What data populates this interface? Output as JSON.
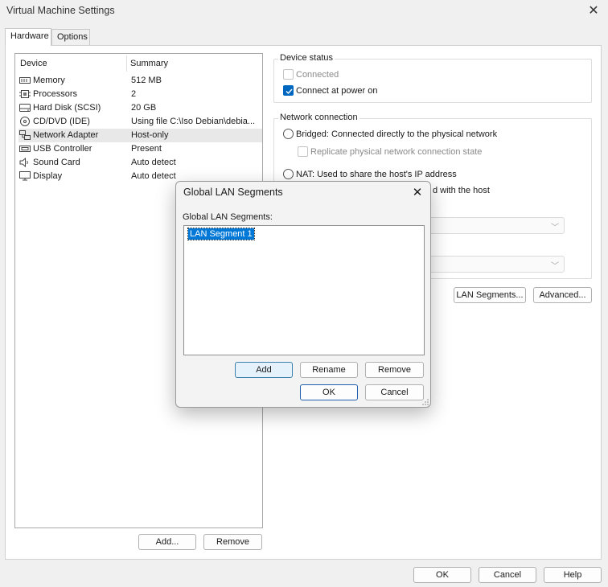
{
  "window": {
    "title": "Virtual Machine Settings"
  },
  "tabs": [
    {
      "label": "Hardware"
    },
    {
      "label": "Options"
    }
  ],
  "device_list": {
    "headers": {
      "device": "Device",
      "summary": "Summary"
    },
    "rows": [
      {
        "icon": "memory-icon",
        "device": "Memory",
        "summary": "512 MB"
      },
      {
        "icon": "processor-icon",
        "device": "Processors",
        "summary": "2"
      },
      {
        "icon": "hard-disk-icon",
        "device": "Hard Disk (SCSI)",
        "summary": "20 GB"
      },
      {
        "icon": "cd-dvd-icon",
        "device": "CD/DVD (IDE)",
        "summary": "Using file C:\\Iso Debian\\debia..."
      },
      {
        "icon": "network-adapter-icon",
        "device": "Network Adapter",
        "summary": "Host-only",
        "selected": true
      },
      {
        "icon": "usb-icon",
        "device": "USB Controller",
        "summary": "Present"
      },
      {
        "icon": "sound-card-icon",
        "device": "Sound Card",
        "summary": "Auto detect"
      },
      {
        "icon": "display-icon",
        "device": "Display",
        "summary": "Auto detect"
      }
    ],
    "add_label": "Add...",
    "remove_label": "Remove"
  },
  "device_status": {
    "title": "Device status",
    "connected": {
      "label": "Connected",
      "checked": false,
      "disabled": true
    },
    "connect_at_power_on": {
      "label": "Connect at power on",
      "checked": true
    }
  },
  "network_connection": {
    "title": "Network connection",
    "bridged": {
      "label": "Bridged: Connected directly to the physical network"
    },
    "replicate": {
      "label": "Replicate physical network connection state",
      "disabled": true
    },
    "nat": {
      "label": "NAT: Used to share the host's IP address"
    },
    "hostonly_partial": "d with the host",
    "lan_segments_label": "LAN Segments...",
    "advanced_label": "Advanced..."
  },
  "footer": {
    "ok": "OK",
    "cancel": "Cancel",
    "help": "Help"
  },
  "dialog": {
    "title": "Global LAN Segments",
    "list_label": "Global LAN Segments:",
    "segments": [
      "LAN Segment 1"
    ],
    "add": "Add",
    "rename": "Rename",
    "remove": "Remove",
    "ok": "OK",
    "cancel": "Cancel"
  },
  "colors": {
    "accent": "#0067c0",
    "selection": "#0078d7"
  }
}
